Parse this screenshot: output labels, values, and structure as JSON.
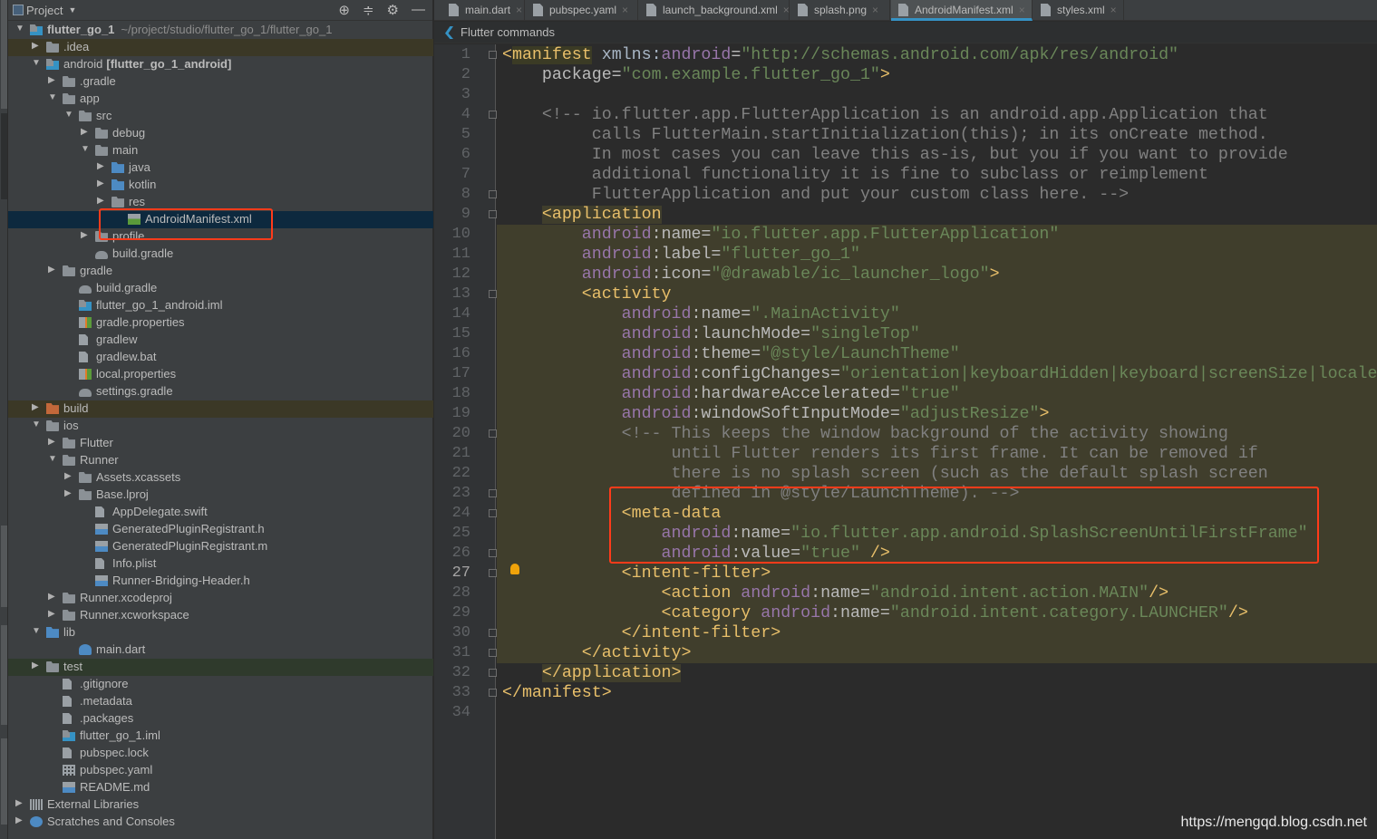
{
  "project_panel": {
    "title": "Project",
    "tree": [
      {
        "level": 0,
        "arrow": "open",
        "icon": "module",
        "label": "flutter_go_1",
        "bold": true,
        "path": "~/project/studio/flutter_go_1/flutter_go_1"
      },
      {
        "level": 1,
        "arrow": "closed",
        "icon": "folder",
        "label": ".idea",
        "bg": "excl"
      },
      {
        "level": 1,
        "arrow": "open",
        "icon": "module",
        "label": "android",
        "boldsuffix": "[flutter_go_1_android]"
      },
      {
        "level": 2,
        "arrow": "closed",
        "icon": "folder",
        "label": ".gradle"
      },
      {
        "level": 2,
        "arrow": "open",
        "icon": "folder",
        "label": "app"
      },
      {
        "level": 3,
        "arrow": "open",
        "icon": "folder",
        "label": "src"
      },
      {
        "level": 4,
        "arrow": "closed",
        "icon": "folder",
        "label": "debug"
      },
      {
        "level": 4,
        "arrow": "open",
        "icon": "folder",
        "label": "main"
      },
      {
        "level": 5,
        "arrow": "closed",
        "icon": "folder-blue",
        "label": "java"
      },
      {
        "level": 5,
        "arrow": "closed",
        "icon": "folder-blue",
        "label": "kotlin"
      },
      {
        "level": 5,
        "arrow": "closed",
        "icon": "folder",
        "label": "res"
      },
      {
        "level": 6,
        "arrow": "none",
        "icon": "mf",
        "label": "AndroidManifest.xml",
        "bg": "sel"
      },
      {
        "level": 4,
        "arrow": "closed",
        "icon": "folder",
        "label": "profile"
      },
      {
        "level": 4,
        "arrow": "none",
        "icon": "gradle",
        "label": "build.gradle"
      },
      {
        "level": 2,
        "arrow": "closed",
        "icon": "folder",
        "label": "gradle"
      },
      {
        "level": 3,
        "arrow": "none",
        "icon": "gradle",
        "label": "build.gradle"
      },
      {
        "level": 3,
        "arrow": "none",
        "icon": "module",
        "label": "flutter_go_1_android.iml"
      },
      {
        "level": 3,
        "arrow": "none",
        "icon": "props",
        "label": "gradle.properties"
      },
      {
        "level": 3,
        "arrow": "none",
        "icon": "file",
        "label": "gradlew"
      },
      {
        "level": 3,
        "arrow": "none",
        "icon": "file",
        "label": "gradlew.bat"
      },
      {
        "level": 3,
        "arrow": "none",
        "icon": "props",
        "label": "local.properties"
      },
      {
        "level": 3,
        "arrow": "none",
        "icon": "gradle",
        "label": "settings.gradle"
      },
      {
        "level": 1,
        "arrow": "closed",
        "icon": "folder-orange",
        "label": "build",
        "bg": "excl"
      },
      {
        "level": 1,
        "arrow": "open",
        "icon": "folder",
        "label": "ios"
      },
      {
        "level": 2,
        "arrow": "closed",
        "icon": "folder",
        "label": "Flutter"
      },
      {
        "level": 2,
        "arrow": "open",
        "icon": "folder",
        "label": "Runner"
      },
      {
        "level": 3,
        "arrow": "closed",
        "icon": "folder",
        "label": "Assets.xcassets"
      },
      {
        "level": 3,
        "arrow": "closed",
        "icon": "folder",
        "label": "Base.lproj"
      },
      {
        "level": 4,
        "arrow": "none",
        "icon": "file",
        "label": "AppDelegate.swift"
      },
      {
        "level": 4,
        "arrow": "none",
        "icon": "code",
        "label": "GeneratedPluginRegistrant.h"
      },
      {
        "level": 4,
        "arrow": "none",
        "icon": "code",
        "label": "GeneratedPluginRegistrant.m"
      },
      {
        "level": 4,
        "arrow": "none",
        "icon": "file",
        "label": "Info.plist"
      },
      {
        "level": 4,
        "arrow": "none",
        "icon": "code",
        "label": "Runner-Bridging-Header.h"
      },
      {
        "level": 2,
        "arrow": "closed",
        "icon": "folder",
        "label": "Runner.xcodeproj"
      },
      {
        "level": 2,
        "arrow": "closed",
        "icon": "folder",
        "label": "Runner.xcworkspace"
      },
      {
        "level": 1,
        "arrow": "open",
        "icon": "folder-blue",
        "label": "lib"
      },
      {
        "level": 3,
        "arrow": "none",
        "icon": "dart",
        "label": "main.dart"
      },
      {
        "level": 1,
        "arrow": "closed",
        "icon": "folder",
        "label": "test",
        "bg": "testbg"
      },
      {
        "level": 2,
        "arrow": "none",
        "icon": "file",
        "label": ".gitignore"
      },
      {
        "level": 2,
        "arrow": "none",
        "icon": "file",
        "label": ".metadata"
      },
      {
        "level": 2,
        "arrow": "none",
        "icon": "file",
        "label": ".packages"
      },
      {
        "level": 2,
        "arrow": "none",
        "icon": "module",
        "label": "flutter_go_1.iml"
      },
      {
        "level": 2,
        "arrow": "none",
        "icon": "file",
        "label": "pubspec.lock"
      },
      {
        "level": 2,
        "arrow": "none",
        "icon": "table",
        "label": "pubspec.yaml"
      },
      {
        "level": 2,
        "arrow": "none",
        "icon": "code",
        "label": "README.md"
      },
      {
        "level": 0,
        "arrow": "closed",
        "icon": "lib",
        "label": "External Libraries"
      },
      {
        "level": 0,
        "arrow": "closed",
        "icon": "scratch",
        "label": "Scratches and Consoles"
      }
    ]
  },
  "tabs": [
    {
      "label": "main.dart",
      "icon": "dart-file-icon"
    },
    {
      "label": "pubspec.yaml",
      "icon": "yaml-file-icon"
    },
    {
      "label": "launch_background.xml",
      "icon": "xml-file-icon"
    },
    {
      "label": "splash.png",
      "icon": "image-file-icon"
    },
    {
      "label": "AndroidManifest.xml",
      "icon": "manifest-file-icon",
      "active": true
    },
    {
      "label": "styles.xml",
      "icon": "xml-file-icon"
    }
  ],
  "breadcrumb": "Flutter commands",
  "editor": {
    "current_line": 27,
    "highlight_range": [
      9,
      32
    ],
    "lines": [
      [
        [
          "t",
          "<"
        ],
        [
          "t tagbg",
          "manifest"
        ],
        [
          "p",
          " xmlns:"
        ],
        [
          "a",
          "android"
        ],
        [
          "n",
          "="
        ],
        [
          "s",
          "\"http://schemas.android.com/apk/res/android\""
        ]
      ],
      [
        [
          "n",
          "    package="
        ],
        [
          "s",
          "\"com.example.flutter_go_1\""
        ],
        [
          "t",
          ">"
        ]
      ],
      [],
      [
        [
          "c",
          "    <!-- io.flutter.app.FlutterApplication is an android.app.Application that"
        ]
      ],
      [
        [
          "c",
          "         calls FlutterMain.startInitialization(this); in its onCreate method."
        ]
      ],
      [
        [
          "c",
          "         In most cases you can leave this as-is, but you if you want to provide"
        ]
      ],
      [
        [
          "c",
          "         additional functionality it is fine to subclass or reimplement"
        ]
      ],
      [
        [
          "c",
          "         FlutterApplication and put your custom class here. -->"
        ]
      ],
      [
        [
          "p",
          "    "
        ],
        [
          "t",
          "<application"
        ]
      ],
      [
        [
          "p",
          "        "
        ],
        [
          "a",
          "android"
        ],
        [
          "n",
          ":name="
        ],
        [
          "s",
          "\"io.flutter.app.FlutterApplication\""
        ]
      ],
      [
        [
          "p",
          "        "
        ],
        [
          "a",
          "android"
        ],
        [
          "n",
          ":label="
        ],
        [
          "s",
          "\"flutter_go_1\""
        ]
      ],
      [
        [
          "p",
          "        "
        ],
        [
          "a",
          "android"
        ],
        [
          "n",
          ":icon="
        ],
        [
          "s",
          "\"@drawable/ic_launcher_logo\""
        ],
        [
          "t",
          ">"
        ]
      ],
      [
        [
          "p",
          "        "
        ],
        [
          "t",
          "<activity"
        ]
      ],
      [
        [
          "p",
          "            "
        ],
        [
          "a",
          "android"
        ],
        [
          "n",
          ":name="
        ],
        [
          "s",
          "\".MainActivity\""
        ]
      ],
      [
        [
          "p",
          "            "
        ],
        [
          "a",
          "android"
        ],
        [
          "n",
          ":launchMode="
        ],
        [
          "s",
          "\"singleTop\""
        ]
      ],
      [
        [
          "p",
          "            "
        ],
        [
          "a",
          "android"
        ],
        [
          "n",
          ":theme="
        ],
        [
          "s",
          "\"@style/LaunchTheme\""
        ]
      ],
      [
        [
          "p",
          "            "
        ],
        [
          "a",
          "android"
        ],
        [
          "n",
          ":configChanges="
        ],
        [
          "s",
          "\"orientation|keyboardHidden|keyboard|screenSize|locale"
        ]
      ],
      [
        [
          "p",
          "            "
        ],
        [
          "a",
          "android"
        ],
        [
          "n",
          ":hardwareAccelerated="
        ],
        [
          "s",
          "\"true\""
        ]
      ],
      [
        [
          "p",
          "            "
        ],
        [
          "a",
          "android"
        ],
        [
          "n",
          ":windowSoftInputMode="
        ],
        [
          "s",
          "\"adjustResize\""
        ],
        [
          "t",
          ">"
        ]
      ],
      [
        [
          "c",
          "            <!-- This keeps the window background of the activity showing"
        ]
      ],
      [
        [
          "c",
          "                 until Flutter renders its first frame. It can be removed if"
        ]
      ],
      [
        [
          "c",
          "                 there is no splash screen (such as the default splash screen"
        ]
      ],
      [
        [
          "c",
          "                 defined in @style/LaunchTheme). -->"
        ]
      ],
      [
        [
          "p",
          "            "
        ],
        [
          "t",
          "<meta-data"
        ]
      ],
      [
        [
          "p",
          "                "
        ],
        [
          "a",
          "android"
        ],
        [
          "n",
          ":name="
        ],
        [
          "s",
          "\"io.flutter.app.android.SplashScreenUntilFirstFrame\""
        ]
      ],
      [
        [
          "p",
          "                "
        ],
        [
          "a",
          "android"
        ],
        [
          "n",
          ":value="
        ],
        [
          "s",
          "\"true\""
        ],
        [
          "t",
          " />"
        ]
      ],
      [
        [
          "p",
          "            "
        ],
        [
          "t",
          "<intent-filter>"
        ]
      ],
      [
        [
          "p",
          "                "
        ],
        [
          "t",
          "<action "
        ],
        [
          "a",
          "android"
        ],
        [
          "n",
          ":name="
        ],
        [
          "s",
          "\"android.intent.action.MAIN\""
        ],
        [
          "t",
          "/>"
        ]
      ],
      [
        [
          "p",
          "                "
        ],
        [
          "t",
          "<category "
        ],
        [
          "a",
          "android"
        ],
        [
          "n",
          ":name="
        ],
        [
          "s",
          "\"android.intent.category.LAUNCHER\""
        ],
        [
          "t",
          "/>"
        ]
      ],
      [
        [
          "p",
          "            "
        ],
        [
          "t",
          "</intent-filter>"
        ]
      ],
      [
        [
          "p",
          "        "
        ],
        [
          "t",
          "</activity>"
        ]
      ],
      [
        [
          "p",
          "    "
        ],
        [
          "t",
          "</application>"
        ]
      ],
      [
        [
          "t",
          "</manifest>"
        ]
      ],
      []
    ]
  },
  "watermark": "https://mengqd.blog.csdn.net",
  "colors": {
    "accent": "#3592c4",
    "annotation_box": "#ff3b1a",
    "tag": "#e8bf6a",
    "attr_ns": "#9876aa",
    "string": "#6a8759",
    "comment": "#808080"
  }
}
